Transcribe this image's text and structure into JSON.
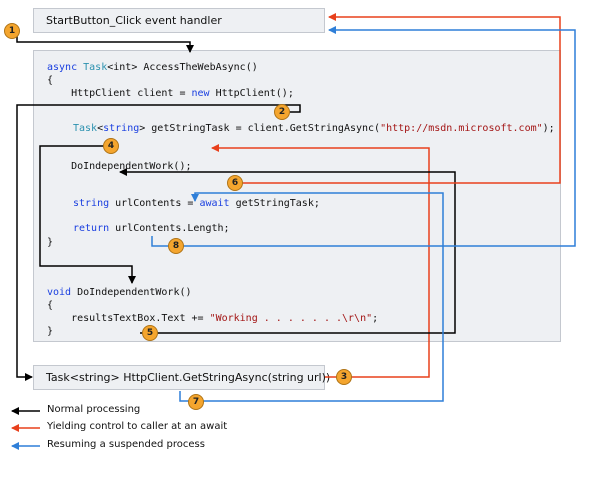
{
  "handler": {
    "label": "StartButton_Click event handler"
  },
  "code": {
    "l1_kw": "async",
    "l1_ty": "Task",
    "l1_rest": "<int> AccessTheWebAsync()",
    "l2": "{",
    "l3_a": "    HttpClient client = ",
    "l3_kw": "new",
    "l3_b": " HttpClient();",
    "l4_ty": "Task",
    "l4_a": "<",
    "l4_kw": "string",
    "l4_b": "> getStringTask = client.GetStringAsync(",
    "l4_str": "\"http://msdn.microsoft.com\"",
    "l4_c": ");",
    "l5": "    DoIndependentWork();",
    "l6_kw": "string",
    "l6_a": " urlContents = ",
    "l6_kw2": "await",
    "l6_b": " getStringTask;",
    "l7_kw": "return",
    "l7_a": " urlContents.Length;",
    "l8": "}",
    "l9_kw": "void",
    "l9_a": " DoIndependentWork()",
    "l10": "{",
    "l11_a": "    resultsTextBox.Text += ",
    "l11_str": "\"Working . . . . . . .\\r\\n\"",
    "l11_b": ";",
    "l12": "}"
  },
  "getstring": {
    "label": "Task<string> HttpClient.GetStringAsync(string url))"
  },
  "badges": [
    "1",
    "2",
    "3",
    "4",
    "5",
    "6",
    "7",
    "8"
  ],
  "legend": [
    {
      "text": "Normal processing",
      "color": "#000000"
    },
    {
      "text": "Yielding control to caller at an await",
      "color": "#e8401c"
    },
    {
      "text": "Resuming a suspended process",
      "color": "#2f7fd8"
    }
  ],
  "colors": {
    "normal": "#000000",
    "yield": "#e8401c",
    "resume": "#2f7fd8",
    "badge": "#f4a52e"
  }
}
